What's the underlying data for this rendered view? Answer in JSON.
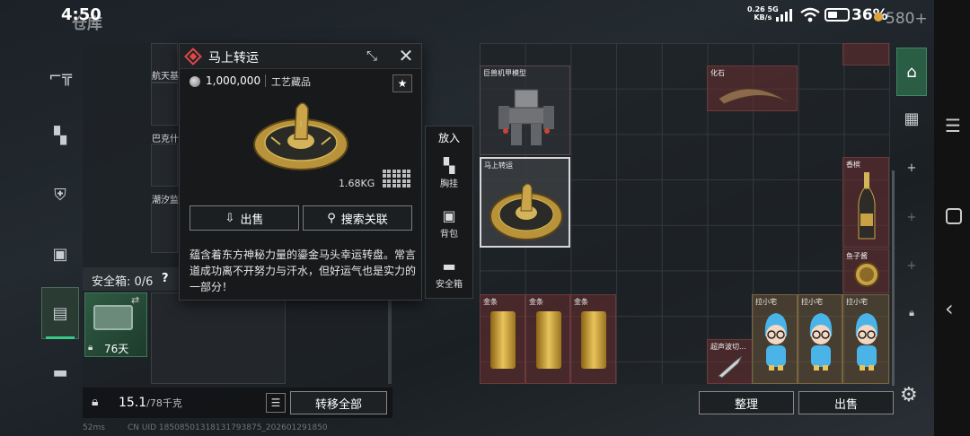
{
  "status_bar": {
    "time": "4:50",
    "network_speed": "0.26",
    "network_unit": "KB/s",
    "network_type": "5G",
    "battery": "36%",
    "background_title": "仓库",
    "currency": "580+"
  },
  "stash": {
    "labels": [
      "航天基",
      "巴克什",
      "潮汐监"
    ],
    "safe_label": "安全箱: 0/6",
    "safe_help": "?",
    "safe_days": "76天",
    "weight_value": "15.1",
    "weight_unit": "/78千克",
    "transfer_all": "转移全部"
  },
  "popup": {
    "title": "马上转运",
    "price": "1,000,000",
    "category": "工艺藏品",
    "fav_icon": "star-icon",
    "weight": "1.68KG",
    "sell_label": "出售",
    "search_label": "搜索关联",
    "description": "蕴含着东方神秘力量的鎏金马头幸运转盘。常言道成功离不开努力与汗水，但好运气也是实力的一部分！"
  },
  "putin": {
    "title": "放入",
    "items": [
      {
        "label": "胸挂",
        "icon": "vest-icon"
      },
      {
        "label": "背包",
        "icon": "backpack-icon"
      },
      {
        "label": "安全箱",
        "icon": "case-icon"
      }
    ]
  },
  "inventory": {
    "items": {
      "mech": "巨兽机甲模型",
      "fossil": "化石",
      "turntable": "马上转运",
      "champagne": "香槟",
      "tin": "鱼子酱",
      "gold1": "金条",
      "gold2": "金条",
      "gold3": "金条",
      "knife": "超声波切...",
      "doll1": "拉小宅",
      "doll2": "拉小宅",
      "doll3": "拉小宅"
    },
    "sort_label": "整理",
    "sell_label": "出售"
  },
  "bottom": {
    "ping": "52ms",
    "uid": "CN UID 18508501318131793875_202601291850"
  }
}
